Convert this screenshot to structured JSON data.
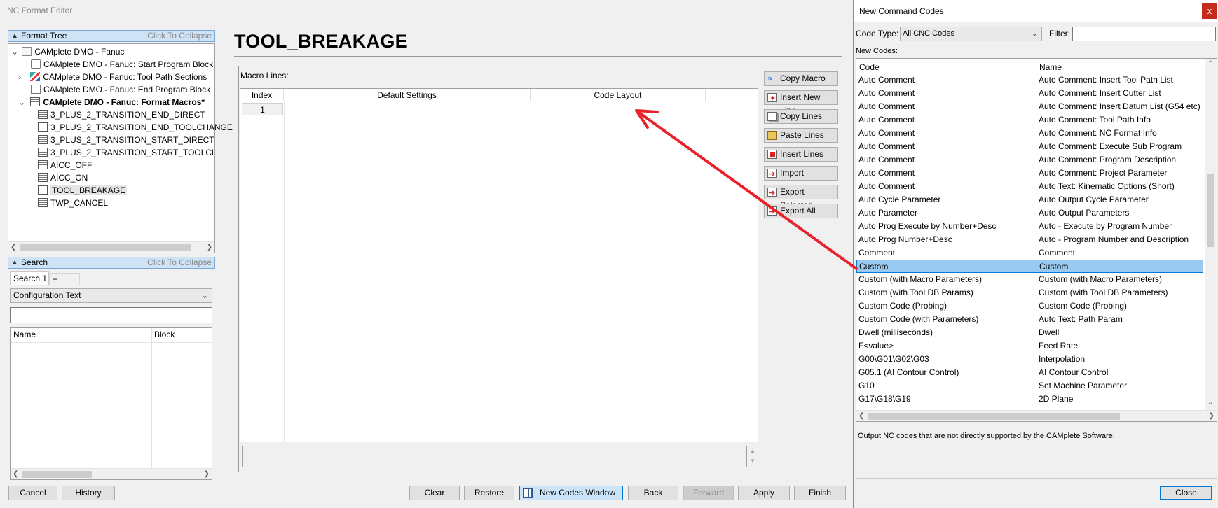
{
  "window": {
    "title": "NC Format Editor"
  },
  "format_tree": {
    "header": "Format Tree",
    "collapse_hint": "Click To Collapse",
    "items": [
      {
        "label": "CAMplete DMO - Fanuc"
      },
      {
        "label": "CAMplete DMO - Fanuc: Start Program Block"
      },
      {
        "label": "CAMplete DMO - Fanuc: Tool Path Sections"
      },
      {
        "label": "CAMplete DMO - Fanuc: End Program Block"
      },
      {
        "label": "CAMplete DMO - Fanuc: Format Macros*"
      },
      {
        "label": "3_PLUS_2_TRANSITION_END_DIRECT"
      },
      {
        "label": "3_PLUS_2_TRANSITION_END_TOOLCHANGE"
      },
      {
        "label": "3_PLUS_2_TRANSITION_START_DIRECT"
      },
      {
        "label": "3_PLUS_2_TRANSITION_START_TOOLCHANGE"
      },
      {
        "label": "AICC_OFF"
      },
      {
        "label": "AICC_ON"
      },
      {
        "label": "TOOL_BREAKAGE"
      },
      {
        "label": "TWP_CANCEL"
      }
    ]
  },
  "search": {
    "header": "Search",
    "collapse_hint": "Click To Collapse",
    "tab_label": "Search 1",
    "add_tab": "+",
    "type_selected": "Configuration Text",
    "query_value": "",
    "columns": [
      "Name",
      "Block"
    ]
  },
  "macro": {
    "title": "TOOL_BREAKAGE",
    "lines_label": "Macro Lines:",
    "columns": [
      "Index",
      "Default Settings",
      "Code Layout"
    ],
    "rows": [
      {
        "index": "1",
        "default": "",
        "layout": ""
      }
    ]
  },
  "macro_buttons": [
    "Copy Macro",
    "Insert New Line",
    "Copy Lines",
    "Paste Lines",
    "Insert Lines",
    "Import",
    "Export Selected",
    "Export All"
  ],
  "bottom_bar": {
    "cancel": "Cancel",
    "history": "History",
    "clear": "Clear",
    "restore": "Restore",
    "new_codes_window": "New Codes Window",
    "back": "Back",
    "forward": "Forward",
    "apply": "Apply",
    "finish": "Finish"
  },
  "new_codes_dialog": {
    "title": "New Command Codes",
    "close_glyph": "x",
    "code_type_label": "Code Type:",
    "code_type_selected": "All CNC Codes",
    "filter_label": "Filter:",
    "filter_value": "",
    "list_label": "New Codes:",
    "columns": [
      "Code",
      "Name"
    ],
    "rows": [
      {
        "code": "Auto Comment",
        "name": "Auto Comment: Insert Tool Path List"
      },
      {
        "code": "Auto Comment",
        "name": "Auto Comment: Insert Cutter List"
      },
      {
        "code": "Auto Comment",
        "name": "Auto Comment: Insert Datum List (G54 etc)"
      },
      {
        "code": "Auto Comment",
        "name": "Auto Comment: Tool Path Info"
      },
      {
        "code": "Auto Comment",
        "name": "Auto Comment: NC Format Info"
      },
      {
        "code": "Auto Comment",
        "name": "Auto Comment: Execute Sub Program"
      },
      {
        "code": "Auto Comment",
        "name": "Auto Comment: Program Description"
      },
      {
        "code": "Auto Comment",
        "name": "Auto Comment: Project Parameter"
      },
      {
        "code": "Auto Comment",
        "name": "Auto Text: Kinematic Options (Short)"
      },
      {
        "code": "Auto Cycle Parameter",
        "name": "Auto Output Cycle Parameter"
      },
      {
        "code": "Auto Parameter",
        "name": "Auto Output Parameters"
      },
      {
        "code": "Auto Prog Execute by Number+Desc",
        "name": "Auto - Execute by Program Number"
      },
      {
        "code": "Auto Prog Number+Desc",
        "name": "Auto - Program Number and Description"
      },
      {
        "code": "Comment",
        "name": "Comment"
      },
      {
        "code": "Custom",
        "name": "Custom"
      },
      {
        "code": "Custom (with Macro Parameters)",
        "name": "Custom (with Macro Parameters)"
      },
      {
        "code": "Custom (with Tool DB Params)",
        "name": "Custom (with Tool DB Parameters)"
      },
      {
        "code": "Custom Code (Probing)",
        "name": "Custom Code (Probing)"
      },
      {
        "code": "Custom Code (with Parameters)",
        "name": "Auto Text: Path Param"
      },
      {
        "code": "Dwell (milliseconds)",
        "name": "Dwell"
      },
      {
        "code": "F<value>",
        "name": "Feed Rate"
      },
      {
        "code": "G00\\G01\\G02\\G03",
        "name": "Interpolation"
      },
      {
        "code": "G05.1 (AI Contour Control)",
        "name": "AI Contour Control"
      },
      {
        "code": "G10",
        "name": "Set Machine Parameter"
      },
      {
        "code": "G17\\G18\\G19",
        "name": "2D Plane"
      }
    ],
    "selected_index": 14,
    "description": "Output NC codes that are not directly supported by the CAMplete Software.",
    "close_button": "Close"
  },
  "colors": {
    "selection": "#99c9ef",
    "annotation_arrow": "#e8212b",
    "panel_header": "#cfe3f7"
  }
}
